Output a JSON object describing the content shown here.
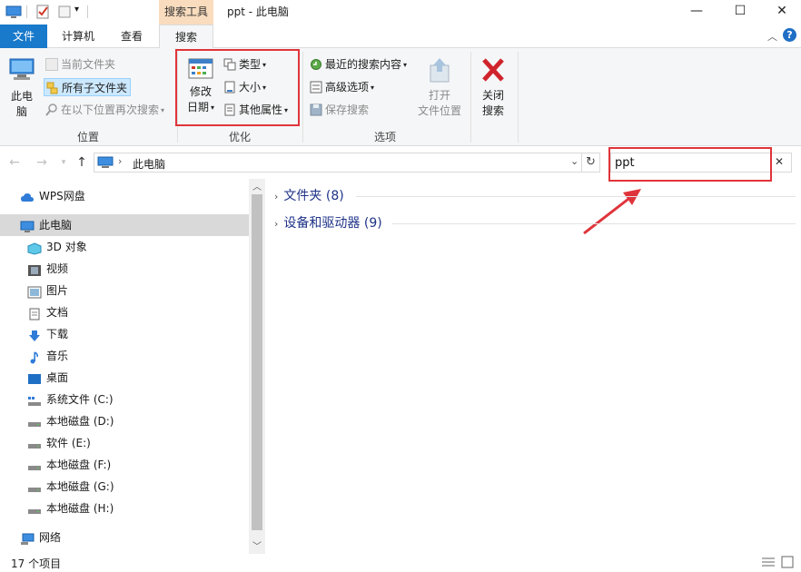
{
  "titlebar": {
    "window_title": "ppt - 此电脑",
    "context_group": "搜索工具",
    "controls": {
      "minimize": "—",
      "maximize": "☐",
      "close": "✕"
    }
  },
  "tabs": {
    "file": "文件",
    "computer": "计算机",
    "view": "查看",
    "search": "搜索"
  },
  "ribbon": {
    "location": {
      "this_pc": "此电\n脑",
      "this_pc_line1": "此电",
      "this_pc_line2": "脑",
      "current_folder": "当前文件夹",
      "all_subfolders": "所有子文件夹",
      "search_again_in": "在以下位置再次搜索",
      "label": "位置"
    },
    "refine": {
      "date_modified_line1": "修改",
      "date_modified_line2": "日期",
      "kind": "类型",
      "size": "大小",
      "other_properties": "其他属性",
      "label": "优化"
    },
    "options": {
      "recent_searches": "最近的搜索内容",
      "advanced_options": "高级选项",
      "save_search": "保存搜索",
      "open_location_line1": "打开",
      "open_location_line2": "文件位置",
      "label": "选项"
    },
    "close": {
      "line1": "关闭",
      "line2": "搜索"
    }
  },
  "address": {
    "path": "此电脑"
  },
  "search": {
    "query": "ppt"
  },
  "nav": {
    "wps": "WPS网盘",
    "this_pc": "此电脑",
    "items": [
      {
        "label": "3D 对象",
        "icon": "cube-3d-icon"
      },
      {
        "label": "视频",
        "icon": "video-icon"
      },
      {
        "label": "图片",
        "icon": "picture-icon"
      },
      {
        "label": "文档",
        "icon": "document-icon"
      },
      {
        "label": "下载",
        "icon": "download-icon"
      },
      {
        "label": "音乐",
        "icon": "music-icon"
      },
      {
        "label": "桌面",
        "icon": "desktop-icon"
      },
      {
        "label": "系统文件 (C:)",
        "icon": "system-drive-icon"
      },
      {
        "label": "本地磁盘 (D:)",
        "icon": "drive-icon"
      },
      {
        "label": "软件 (E:)",
        "icon": "drive-icon"
      },
      {
        "label": "本地磁盘 (F:)",
        "icon": "drive-icon"
      },
      {
        "label": "本地磁盘 (G:)",
        "icon": "drive-icon"
      },
      {
        "label": "本地磁盘 (H:)",
        "icon": "drive-icon"
      }
    ],
    "network": "网络"
  },
  "content": {
    "groups": [
      {
        "label": "文件夹 (8)"
      },
      {
        "label": "设备和驱动器 (9)"
      }
    ]
  },
  "status": {
    "item_count": "17 个项目"
  },
  "colors": {
    "accent": "#1979ca",
    "highlight_red": "#e0343b",
    "context_tab": "#f9dcbe"
  }
}
